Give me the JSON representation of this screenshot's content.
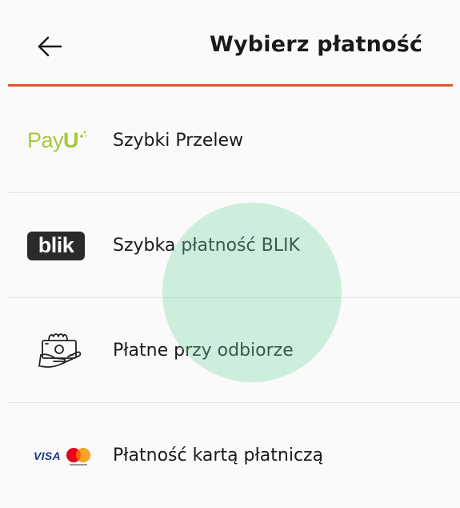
{
  "header": {
    "back_icon": "arrow-left-icon",
    "title": "Wybierz płatność",
    "accent_color": "#e3572a"
  },
  "payment_methods": [
    {
      "logo": "PayU",
      "logo_main": "Pay",
      "logo_accent": "U",
      "label": "Szybki Przelew",
      "logo_color": "#a3c93a"
    },
    {
      "logo": "blik",
      "label": "Szybka płatność BLIK"
    },
    {
      "logo": "cash-on-delivery-icon",
      "label": "Płatne przy odbiorze"
    },
    {
      "logo": "VISA",
      "label": "Płatność kartą płatniczą",
      "secondary_icon": "mastercard-icon"
    }
  ],
  "touch_ripple_color": "#78d7a5"
}
